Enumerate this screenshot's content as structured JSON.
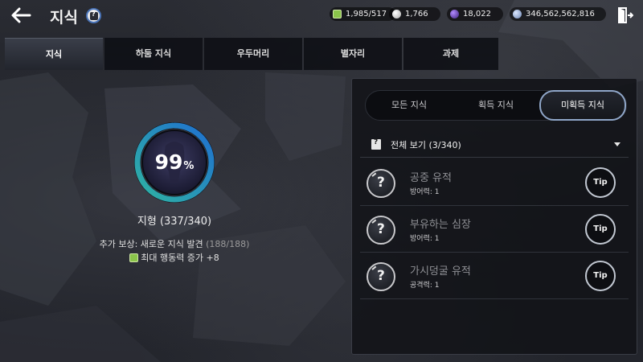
{
  "header": {
    "title": "지식",
    "currencies": [
      {
        "name": "energy",
        "value": "1,985/517"
      },
      {
        "name": "pearl",
        "value": "1,766"
      },
      {
        "name": "gem",
        "value": "18,022"
      },
      {
        "name": "silver",
        "value": "346,562,562,816"
      }
    ]
  },
  "tabs": [
    {
      "label": "지식",
      "active": true
    },
    {
      "label": "하둠 지식",
      "active": false
    },
    {
      "label": "우두머리",
      "active": false
    },
    {
      "label": "별자리",
      "active": false
    },
    {
      "label": "과제",
      "active": false
    }
  ],
  "summary": {
    "percent": "99",
    "percent_unit": "%",
    "progress_fraction": 0.99,
    "region": "지형 (337/340)",
    "bonus_label": "추가 보상: 새로운 지식 발견",
    "bonus_count": "(188/188)",
    "reward": "최대 행동력 증가 +8"
  },
  "segment": {
    "all": "모든 지식",
    "acquired": "획득 지식",
    "unacquired": "미획득 지식",
    "selected": "unacquired"
  },
  "filter": {
    "label": "전체 보기 (3/340)"
  },
  "knowledge_list": [
    {
      "name": "공중 유적",
      "stat": "방어력: 1",
      "tip": "Tip"
    },
    {
      "name": "부유하는 심장",
      "stat": "방어력: 1",
      "tip": "Tip"
    },
    {
      "name": "가시덩굴 유적",
      "stat": "공격력: 1",
      "tip": "Tip"
    }
  ],
  "colors": {
    "ring_start": "#2fb3a3",
    "ring_end": "#1f6fd0",
    "segment_active_border": "#8fa6c8"
  }
}
